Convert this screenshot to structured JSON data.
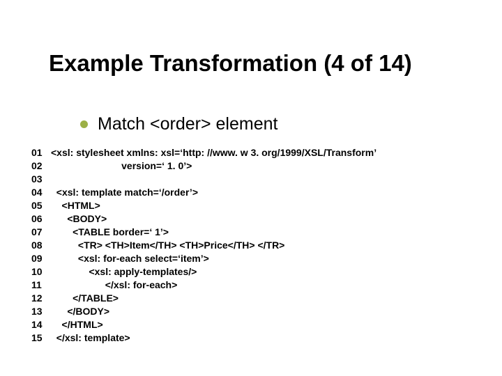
{
  "title": "Example Transformation (4 of 14)",
  "bullet": "Match <order> element",
  "code": {
    "lines": [
      {
        "n": "01",
        "t": "<xsl: stylesheet xmlns: xsl=‘http: //www. w 3. org/1999/XSL/Transform’"
      },
      {
        "n": "02",
        "t": "                          version=‘ 1. 0’>"
      },
      {
        "n": "03",
        "t": ""
      },
      {
        "n": "04",
        "t": "  <xsl: template match=‘/order’>"
      },
      {
        "n": "05",
        "t": "    <HTML>"
      },
      {
        "n": "06",
        "t": "      <BODY>"
      },
      {
        "n": "07",
        "t": "        <TABLE border=‘ 1’>"
      },
      {
        "n": "08",
        "t": "          <TR> <TH>Item</TH> <TH>Price</TH> </TR>"
      },
      {
        "n": "09",
        "t": "          <xsl: for-each select=‘item’>"
      },
      {
        "n": "10",
        "t": "              <xsl: apply-templates/>"
      },
      {
        "n": "11",
        "t": "                    </xsl: for-each>"
      },
      {
        "n": "12",
        "t": "        </TABLE>"
      },
      {
        "n": "13",
        "t": "      </BODY>"
      },
      {
        "n": "14",
        "t": "    </HTML>"
      },
      {
        "n": "15",
        "t": "  </xsl: template>"
      }
    ]
  }
}
